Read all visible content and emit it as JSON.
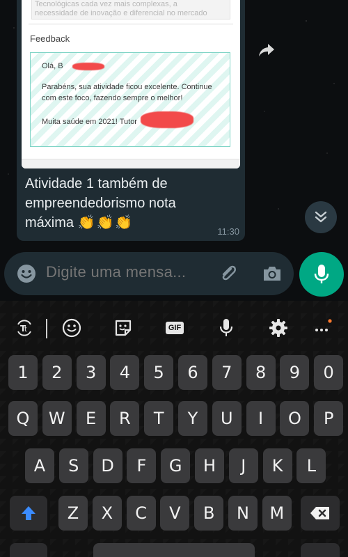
{
  "chat": {
    "preview": {
      "top_text_line1": "Tecnológicas cada vez mais complexas, a",
      "top_text_line2": "necessidade de inovação e diferencial no mercado",
      "feedback_title": "Feedback",
      "greeting": "Olá, B",
      "body_line1": "Parabéns, sua atividade ficou excelente. Continue",
      "body_line2": "com este foco, fazendo sempre o melhor!",
      "signoff": "Muita saúde em 2021! Tutor"
    },
    "message": {
      "line1": "Atividade 1 também de",
      "line2": "empreendedorismo nota",
      "line3": "máxima",
      "emoji": "👏👏👏",
      "time": "11:30"
    }
  },
  "input": {
    "placeholder": "Digite uma mensa..."
  },
  "keyboard": {
    "toolbar_gif": "GIF",
    "row_numbers": [
      "1",
      "2",
      "3",
      "4",
      "5",
      "6",
      "7",
      "8",
      "9",
      "0"
    ],
    "row_top": [
      "Q",
      "W",
      "E",
      "R",
      "T",
      "Y",
      "U",
      "I",
      "O",
      "P"
    ],
    "row_mid": [
      "A",
      "S",
      "D",
      "F",
      "G",
      "H",
      "J",
      "K",
      "L"
    ],
    "row_bottom": [
      "Z",
      "X",
      "C",
      "V",
      "B",
      "N",
      "M"
    ]
  },
  "colors": {
    "accent": "#00a884",
    "bubble": "#1f2c33",
    "redaction": "#f24a4a",
    "feedback_border": "#7fd4c6"
  }
}
